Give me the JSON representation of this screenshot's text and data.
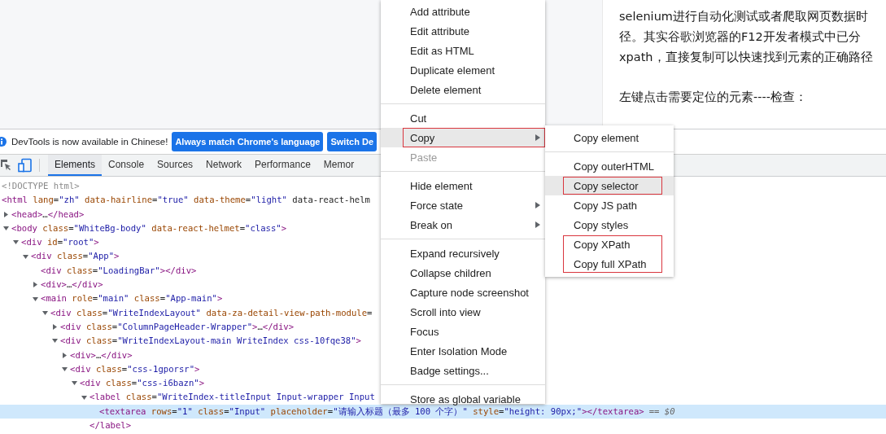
{
  "article": {
    "paragraphs": [
      {
        "lines": [
          "selenium进行自动化测试或者爬取网页数据时",
          "径。其实谷歌浏览器的F12开发者模式中已分",
          "xpath，直接复制可以快速找到元素的正确路径"
        ]
      },
      {
        "lines": [
          "左键点击需要定位的元素----检查："
        ]
      }
    ]
  },
  "devtools": {
    "infobar": {
      "message": "DevTools is now available in Chinese!",
      "buttons": [
        "Always match Chrome's language",
        "Switch De"
      ]
    },
    "tabs": [
      {
        "label": "Elements",
        "selected": true
      },
      {
        "label": "Console",
        "selected": false
      },
      {
        "label": "Sources",
        "selected": false
      },
      {
        "label": "Network",
        "selected": false
      },
      {
        "label": "Performance",
        "selected": false
      },
      {
        "label": "Memor",
        "selected": false
      }
    ],
    "dom_tree": [
      {
        "kind": "doctype",
        "markup": "<!DOCTYPE html>",
        "selected": false
      },
      {
        "kind": "element",
        "markup": "<html lang=\"zh\" data-hairline=\"true\" data-theme=\"light\" data-react-helm",
        "selected": false,
        "children": [
          {
            "kind": "element",
            "markup": "<head>…</head>",
            "expanded": false,
            "selected": false
          },
          {
            "kind": "element",
            "markup": "<body class=\"WhiteBg-body\" data-react-helmet=\"class\">",
            "expanded": true,
            "selected": false,
            "children": [
              {
                "kind": "element",
                "markup": "<div id=\"root\">",
                "expanded": true,
                "selected": false,
                "children": [
                  {
                    "kind": "element",
                    "markup": "<div class=\"App\">",
                    "expanded": true,
                    "selected": false,
                    "children": [
                      {
                        "kind": "element",
                        "markup": "<div class=\"LoadingBar\"></div>",
                        "selected": false
                      },
                      {
                        "kind": "element",
                        "markup": "<div>…</div>",
                        "expanded": false,
                        "selected": false
                      },
                      {
                        "kind": "element",
                        "markup": "<main role=\"main\" class=\"App-main\">",
                        "expanded": true,
                        "selected": false,
                        "children": [
                          {
                            "kind": "element",
                            "markup": "<div class=\"WriteIndexLayout\" data-za-detail-view-path-module=",
                            "expanded": true,
                            "selected": false,
                            "children": [
                              {
                                "kind": "element",
                                "markup": "<div class=\"ColumnPageHeader-Wrapper\">…</div>",
                                "expanded": false,
                                "selected": false
                              },
                              {
                                "kind": "element",
                                "markup": "<div class=\"WriteIndexLayout-main WriteIndex css-10fqe38\">",
                                "expanded": true,
                                "selected": false,
                                "children": [
                                  {
                                    "kind": "element",
                                    "markup": "<div>…</div>",
                                    "expanded": false,
                                    "selected": false
                                  },
                                  {
                                    "kind": "element",
                                    "markup": "<div class=\"css-1gporsr\">",
                                    "expanded": true,
                                    "selected": false,
                                    "children": [
                                      {
                                        "kind": "element",
                                        "markup": "<div class=\"css-i6bazn\">",
                                        "expanded": true,
                                        "selected": false,
                                        "children": [
                                          {
                                            "kind": "element",
                                            "markup": "<label class=\"WriteIndex-titleInput Input-wrapper Input",
                                            "expanded": true,
                                            "selected": false,
                                            "closing": "</label>",
                                            "children": [
                                              {
                                                "kind": "element",
                                                "markup": "<textarea rows=\"1\" class=\"Input\" placeholder=\"请输入标题（最多 100 个字）\" style=\"height: 90px;\"></textarea>",
                                                "selected": true,
                                                "marker": "== $0"
                                              }
                                            ]
                                          }
                                        ]
                                      }
                                    ]
                                  }
                                ]
                              }
                            ]
                          }
                        ]
                      }
                    ]
                  }
                ]
              }
            ]
          }
        ]
      }
    ]
  },
  "context_menu": {
    "items": [
      {
        "kind": "item",
        "label": "Add attribute",
        "selected": false,
        "disabled": false,
        "submenu": false,
        "annotated": false
      },
      {
        "kind": "item",
        "label": "Edit attribute",
        "selected": false,
        "disabled": false,
        "submenu": false,
        "annotated": false
      },
      {
        "kind": "item",
        "label": "Edit as HTML",
        "selected": false,
        "disabled": false,
        "submenu": false,
        "annotated": false
      },
      {
        "kind": "item",
        "label": "Duplicate element",
        "selected": false,
        "disabled": false,
        "submenu": false,
        "annotated": false
      },
      {
        "kind": "item",
        "label": "Delete element",
        "selected": false,
        "disabled": false,
        "submenu": false,
        "annotated": false
      },
      {
        "kind": "separator"
      },
      {
        "kind": "item",
        "label": "Cut",
        "selected": false,
        "disabled": false,
        "submenu": false,
        "annotated": false
      },
      {
        "kind": "item",
        "label": "Copy",
        "selected": true,
        "disabled": false,
        "submenu": true,
        "annotated": true
      },
      {
        "kind": "item",
        "label": "Paste",
        "selected": false,
        "disabled": true,
        "submenu": false,
        "annotated": false
      },
      {
        "kind": "separator"
      },
      {
        "kind": "item",
        "label": "Hide element",
        "selected": false,
        "disabled": false,
        "submenu": false,
        "annotated": false
      },
      {
        "kind": "item",
        "label": "Force state",
        "selected": false,
        "disabled": false,
        "submenu": true,
        "annotated": false
      },
      {
        "kind": "item",
        "label": "Break on",
        "selected": false,
        "disabled": false,
        "submenu": true,
        "annotated": false
      },
      {
        "kind": "separator"
      },
      {
        "kind": "item",
        "label": "Expand recursively",
        "selected": false,
        "disabled": false,
        "submenu": false,
        "annotated": false
      },
      {
        "kind": "item",
        "label": "Collapse children",
        "selected": false,
        "disabled": false,
        "submenu": false,
        "annotated": false
      },
      {
        "kind": "item",
        "label": "Capture node screenshot",
        "selected": false,
        "disabled": false,
        "submenu": false,
        "annotated": false
      },
      {
        "kind": "item",
        "label": "Scroll into view",
        "selected": false,
        "disabled": false,
        "submenu": false,
        "annotated": false
      },
      {
        "kind": "item",
        "label": "Focus",
        "selected": false,
        "disabled": false,
        "submenu": false,
        "annotated": false
      },
      {
        "kind": "item",
        "label": "Enter Isolation Mode",
        "selected": false,
        "disabled": false,
        "submenu": false,
        "annotated": false
      },
      {
        "kind": "item",
        "label": "Badge settings...",
        "selected": false,
        "disabled": false,
        "submenu": false,
        "annotated": false
      },
      {
        "kind": "separator"
      },
      {
        "kind": "item",
        "label": "Store as global variable",
        "selected": false,
        "disabled": false,
        "submenu": false,
        "annotated": false
      }
    ]
  },
  "submenu": {
    "items": [
      {
        "kind": "item",
        "label": "Copy element",
        "selected": false,
        "annotated": false
      },
      {
        "kind": "separator"
      },
      {
        "kind": "item",
        "label": "Copy outerHTML",
        "selected": false,
        "annotated": false
      },
      {
        "kind": "item",
        "label": "Copy selector",
        "selected": true,
        "annotated": true
      },
      {
        "kind": "item",
        "label": "Copy JS path",
        "selected": false,
        "annotated": false
      },
      {
        "kind": "item",
        "label": "Copy styles",
        "selected": false,
        "annotated": false
      },
      {
        "kind": "item",
        "label": "Copy XPath",
        "selected": false,
        "annotated": true
      },
      {
        "kind": "item",
        "label": "Copy full XPath",
        "selected": false,
        "annotated": true
      }
    ]
  }
}
